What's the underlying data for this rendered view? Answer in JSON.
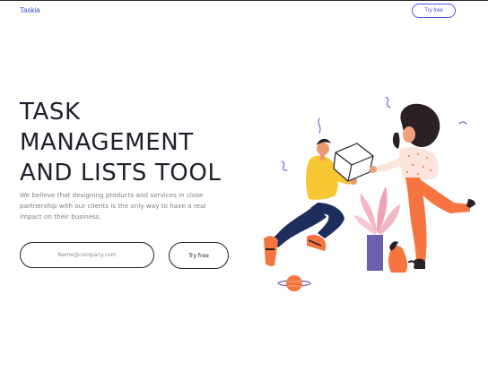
{
  "nav": {
    "brand": "Taskia",
    "try_free_label": "Try free"
  },
  "hero": {
    "title_lines": [
      "TASK",
      "MANAGEMENT",
      "AND LISTS TOOL"
    ],
    "description": "We believe that designing products and services in close partnership with our clients is the only way to have a real impact on their business.",
    "email_placeholder": "Name@company.com",
    "cta_label": "Try free"
  },
  "colors": {
    "accent": "#3d4bd8",
    "text_dark": "#1f1f2b",
    "text_muted": "#7d7f88",
    "shirt_yellow": "#f6c733",
    "pants_navy": "#1d2e5c",
    "orange": "#f6743f",
    "skin_dark": "#2b2026",
    "plant_pink": "#f4b6c5",
    "pot_purple": "#6d5eae"
  },
  "illustration": {
    "name": "two-people-exchanging-box-illustration"
  }
}
